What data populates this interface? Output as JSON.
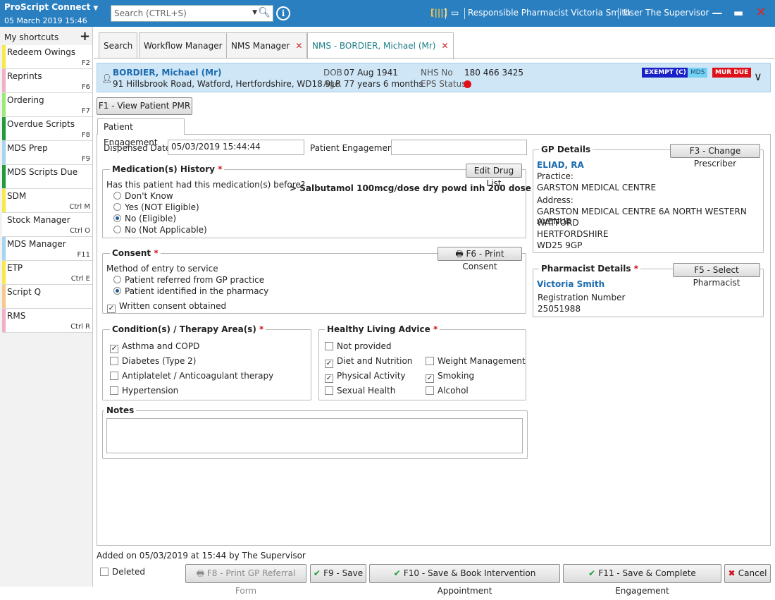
{
  "titlebar": {
    "brand": "ProScript Connect",
    "date": "05 March 2019 15:46",
    "search_placeholder": "Search (CTRL+S)",
    "responsible_pharmacist": "Responsible Pharmacist Victoria Smith",
    "user": "User The Supervisor"
  },
  "sidebar": {
    "header": "My shortcuts",
    "items": [
      {
        "label": "Redeem Owings",
        "key": "F2",
        "color": "#f7e94a"
      },
      {
        "label": "Reprints",
        "key": "F6",
        "color": "#f0b0c8"
      },
      {
        "label": "Ordering",
        "key": "F7",
        "color": "#9ee87a"
      },
      {
        "label": "Overdue Scripts",
        "key": "F8",
        "color": "#1f9b3c"
      },
      {
        "label": "MDS Prep",
        "key": "F9",
        "color": "#a8d4f0"
      },
      {
        "label": "MDS Scripts Due",
        "key": "",
        "color": "#1f9b3c"
      },
      {
        "label": "SDM",
        "key": "Ctrl M",
        "color": "#f7e94a"
      },
      {
        "label": "Stock Manager",
        "key": "Ctrl O",
        "color": "#ffffff"
      },
      {
        "label": "MDS Manager",
        "key": "F11",
        "color": "#a8d4f0"
      },
      {
        "label": "ETP",
        "key": "Ctrl E",
        "color": "#f7e94a"
      },
      {
        "label": "Script Q",
        "key": "",
        "color": "#f5c98a"
      },
      {
        "label": "RMS",
        "key": "Ctrl R",
        "color": "#f0b0c8"
      }
    ]
  },
  "tabs": [
    {
      "label": "Search"
    },
    {
      "label": "Workflow Manager"
    },
    {
      "label": "NMS Manager"
    },
    {
      "label": "NMS - BORDIER, Michael (Mr)"
    }
  ],
  "patient": {
    "name": "BORDIER, Michael (Mr)",
    "address": "91 Hillsbrook Road, Watford, Hertfordshire, WD18 9LR",
    "dob_label": "DOB",
    "dob": "07 Aug 1941",
    "age_label": "Age",
    "age": "77 years 6 months",
    "nhs_label": "NHS No",
    "nhs": "180 466 3425",
    "eps_label": "EPS Status",
    "badges": [
      "EXEMPT (C)",
      "MDS",
      "MUR DUE"
    ]
  },
  "pmr_button": "F1 - View Patient PMR",
  "subtab": "Patient Engagement",
  "form": {
    "dispensed_label": "Dispensed Date",
    "dispensed_value": "05/03/2019 15:44:44",
    "engagement_label": "Patient Engagement",
    "engagement_value": ""
  },
  "medication": {
    "title": "Medication(s) History",
    "edit_button": "Edit Drug List",
    "question": "Has this patient had this medication(s) before?",
    "drug": ">  Salbutamol 100mcg/dose dry powd inh 200 dose",
    "options": [
      "Don't Know",
      "Yes (NOT Eligible)",
      "No (Eligible)",
      "No (Not Applicable)"
    ],
    "selected": 2
  },
  "consent": {
    "title": "Consent",
    "print_button": "F6 - Print Consent",
    "method_label": "Method of entry to service",
    "options": [
      "Patient referred from GP practice",
      "Patient identified in the pharmacy"
    ],
    "selected": 1,
    "written_label": "Written consent obtained",
    "written_checked": true
  },
  "conditions": {
    "title": "Condition(s) / Therapy Area(s)",
    "items": [
      {
        "label": "Asthma and COPD",
        "checked": true
      },
      {
        "label": "Diabetes (Type 2)",
        "checked": false
      },
      {
        "label": "Antiplatelet / Anticoagulant therapy",
        "checked": false
      },
      {
        "label": "Hypertension",
        "checked": false
      }
    ]
  },
  "healthy": {
    "title": "Healthy Living Advice",
    "items": [
      {
        "label": "Not provided",
        "checked": false
      },
      {
        "label": "Diet and Nutrition",
        "checked": true
      },
      {
        "label": "Weight Management",
        "checked": false
      },
      {
        "label": "Physical Activity",
        "checked": true
      },
      {
        "label": "Smoking",
        "checked": true
      },
      {
        "label": "Sexual Health",
        "checked": false
      },
      {
        "label": "Alcohol",
        "checked": false
      }
    ]
  },
  "notes": {
    "title": "Notes",
    "value": ""
  },
  "gp": {
    "title": "GP Details",
    "change_button": "F3 - Change Prescriber",
    "name": "ELIAD, RA",
    "practice_label": "Practice:",
    "practice": "GARSTON MEDICAL CENTRE",
    "address_label": "Address:",
    "address_lines": [
      "GARSTON MEDICAL CENTRE 6A NORTH WESTERN AVENUE",
      "WATFORD",
      "HERTFORDSHIRE",
      "WD25 9GP"
    ]
  },
  "pharmacist": {
    "title": "Pharmacist Details",
    "select_button": "F5 - Select Pharmacist",
    "name": "Victoria Smith",
    "reg_label": "Registration Number",
    "reg": "25051988"
  },
  "footer": {
    "added": "Added on 05/03/2019 at 15:44 by The Supervisor",
    "deleted_label": "Deleted",
    "deleted_checked": false,
    "print_referral": "F8 - Print GP Referral Form",
    "save": "F9 - Save",
    "save_book": "F10 - Save & Book Intervention Appointment",
    "save_complete": "F11 - Save & Complete Engagement",
    "cancel": "Cancel"
  }
}
